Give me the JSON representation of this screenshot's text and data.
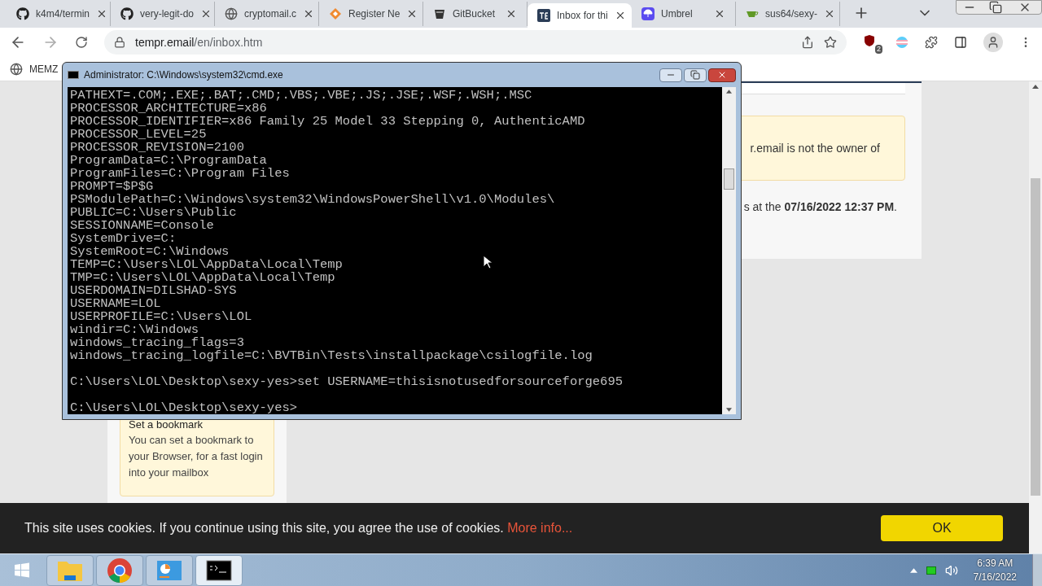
{
  "browser": {
    "tabs": [
      {
        "title": "k4m4/termin",
        "kind": "github",
        "selected": false
      },
      {
        "title": "very-legit-do",
        "kind": "github",
        "selected": false
      },
      {
        "title": "cryptomail.c",
        "kind": "globe",
        "selected": false
      },
      {
        "title": "Register Ne",
        "kind": "diamond",
        "selected": false
      },
      {
        "title": "GitBucket",
        "kind": "bucket",
        "selected": false
      },
      {
        "title": "Inbox for thi",
        "kind": "te",
        "selected": true
      },
      {
        "title": "Umbrel",
        "kind": "umbrel",
        "selected": false
      },
      {
        "title": "sus64/sexy-",
        "kind": "tea",
        "selected": false
      }
    ],
    "url_host": "tempr.email",
    "url_path": "/en/inbox.htm",
    "extension_badge": "2",
    "bookmarks": [
      "MEMZ"
    ]
  },
  "page": {
    "notice": "r.email is not the owner of",
    "date_sentence": "s at the **07/16/2022 12:37 PM**.",
    "bookmark_tip": {
      "title": "Set a bookmark",
      "text": "You can set a bookmark to your Browser, for a fast login into your mailbox"
    }
  },
  "cmd": {
    "title": "Administrator: C:\\Windows\\system32\\cmd.exe",
    "blocks": [
      [
        "PATHEXT=.COM;.EXE;.BAT;.CMD;.VBS;.VBE;.JS;.JSE;.WSF;.WSH;.MSC",
        "PROCESSOR_ARCHITECTURE=x86",
        "PROCESSOR_IDENTIFIER=x86 Family 25 Model 33 Stepping 0, AuthenticAMD",
        "PROCESSOR_LEVEL=25",
        "PROCESSOR_REVISION=2100",
        "ProgramData=C:\\ProgramData",
        "ProgramFiles=C:\\Program Files",
        "PROMPT=$P$G",
        "PSModulePath=C:\\Windows\\system32\\WindowsPowerShell\\v1.0\\Modules\\",
        "PUBLIC=C:\\Users\\Public",
        "SESSIONNAME=Console",
        "SystemDrive=C:",
        "SystemRoot=C:\\Windows",
        "TEMP=C:\\Users\\LOL\\AppData\\Local\\Temp",
        "TMP=C:\\Users\\LOL\\AppData\\Local\\Temp",
        "USERDOMAIN=DILSHAD-SYS",
        "USERNAME=LOL",
        "USERPROFILE=C:\\Users\\LOL",
        "windir=C:\\Windows",
        "windows_tracing_flags=3",
        "windows_tracing_logfile=C:\\BVTBin\\Tests\\installpackage\\csilogfile.log"
      ],
      [
        "C:\\Users\\LOL\\Desktop\\sexy-yes>set USERNAME=thisisnotusedforsourceforge695"
      ],
      [
        "C:\\Users\\LOL\\Desktop\\sexy-yes>"
      ]
    ]
  },
  "cookie_bar": {
    "text": "This site uses cookies. If you continue using this site, you agree the use of cookies.",
    "link": "More info...",
    "button": "OK"
  },
  "taskbar": {
    "apps": [
      {
        "kind": "folder",
        "active": false
      },
      {
        "kind": "chrome",
        "active": false
      },
      {
        "kind": "panel",
        "active": false
      },
      {
        "kind": "cmd",
        "active": true
      }
    ],
    "time": "6:39 AM",
    "date": "7/16/2022"
  }
}
